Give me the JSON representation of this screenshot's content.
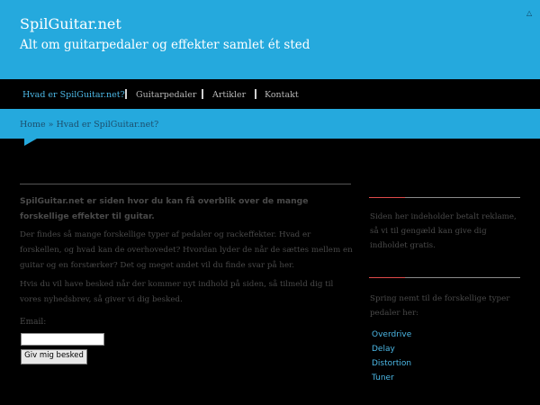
{
  "header": {
    "site_title": "SpilGuitar.net",
    "tagline": "Alt om guitarpedaler og effekter samlet ét sted",
    "corner_icon": "triangle-up-icon"
  },
  "nav": {
    "items": [
      {
        "label": "Hvad er SpilGuitar.net?",
        "active": true
      },
      {
        "label": "Guitarpedaler",
        "active": false
      },
      {
        "label": "Artikler",
        "active": false
      },
      {
        "label": "Kontakt",
        "active": false
      }
    ]
  },
  "breadcrumb": {
    "home": "Home",
    "separator": " » ",
    "current": "Hvad er SpilGuitar.net?"
  },
  "main": {
    "lead": "SpilGuitar.net er siden hvor du kan få overblik over de mange forskellige effekter til guitar.",
    "para1": "Der findes så mange forskellige typer af pedaler og rackeffekter. Hvad er forskellen, og hvad kan de overhovedet? Hvordan lyder de når de sættes mellem en guitar og en forstærker? Det og meget andet vil du finde svar på her.",
    "para2": "Hvis du vil have besked når der kommer nyt indhold på siden, så tilmeld dig til vores nyhedsbrev, så giver vi dig besked.",
    "email_label": "Email:",
    "email_value": "",
    "submit_label": "Giv mig besked"
  },
  "sidebar": {
    "notice": "Siden her indeholder betalt reklame, så vi til gengæld kan give dig indholdet gratis.",
    "intro": "Spring nemt til de forskellige typer pedaler her:",
    "links": [
      "Overdrive",
      "Delay",
      "Distortion",
      "Tuner"
    ]
  },
  "colors": {
    "brand_blue": "#25a9dd",
    "link_blue": "#4cb8e6",
    "background": "#000000",
    "body_text": "#4a4a4a",
    "accent_red": "#e04a4a"
  }
}
